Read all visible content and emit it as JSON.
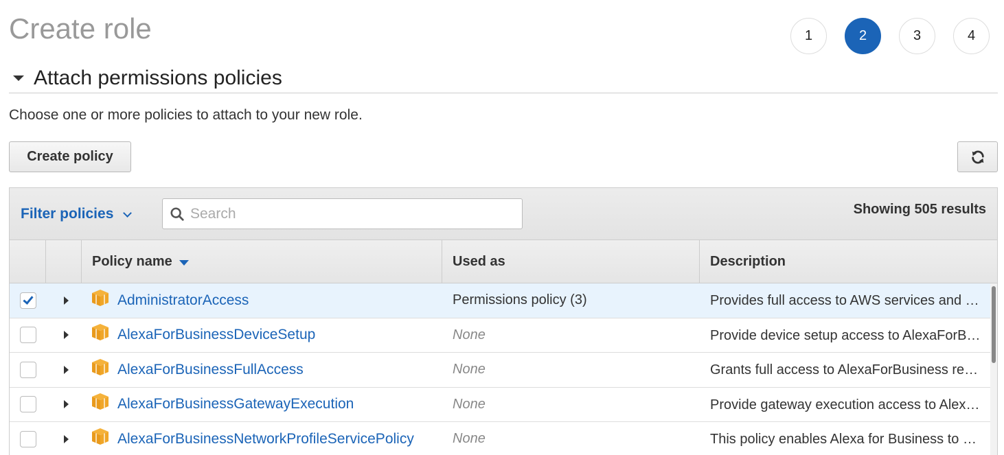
{
  "page": {
    "title": "Create role",
    "steps": [
      "1",
      "2",
      "3",
      "4"
    ],
    "active_step": "2"
  },
  "section": {
    "title": "Attach permissions policies",
    "intro": "Choose one or more policies to attach to your new role."
  },
  "actions": {
    "create_policy_label": "Create policy",
    "refresh_icon": "refresh-icon"
  },
  "toolbar": {
    "filter_label": "Filter policies",
    "search_placeholder": "Search",
    "results_text": "Showing 505 results"
  },
  "table": {
    "columns": [
      "Policy name",
      "Used as",
      "Description"
    ],
    "rows": [
      {
        "checked": true,
        "name": "AdministratorAccess",
        "used_as": "Permissions policy (3)",
        "description": "Provides full access to AWS services and resources."
      },
      {
        "checked": false,
        "name": "AlexaForBusinessDeviceSetup",
        "used_as": "None",
        "description": "Provide device setup access to AlexaForBusiness services"
      },
      {
        "checked": false,
        "name": "AlexaForBusinessFullAccess",
        "used_as": "None",
        "description": "Grants full access to AlexaForBusiness resources and access to related AWS Services"
      },
      {
        "checked": false,
        "name": "AlexaForBusinessGatewayExecution",
        "used_as": "None",
        "description": "Provide gateway execution access to AlexaForBusiness services"
      },
      {
        "checked": false,
        "name": "AlexaForBusinessNetworkProfileServicePolicy",
        "used_as": "None",
        "description": "This policy enables Alexa for Business to perform automated tasks"
      }
    ]
  },
  "colors": {
    "accent": "#1b64b7",
    "selected_row": "#e8f3fd",
    "policy_icon": "#f0a020"
  }
}
